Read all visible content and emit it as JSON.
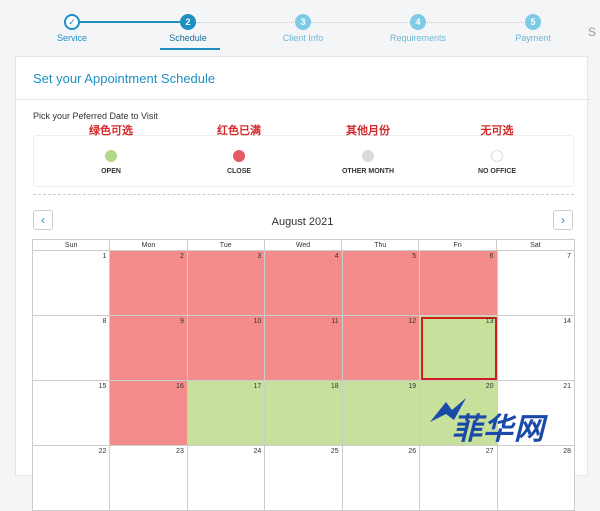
{
  "stepper": {
    "steps": [
      {
        "num": "✓",
        "label": "Service",
        "state": "done"
      },
      {
        "num": "2",
        "label": "Schedule",
        "state": "active"
      },
      {
        "num": "3",
        "label": "Client Info",
        "state": "todo"
      },
      {
        "num": "4",
        "label": "Requirements",
        "state": "todo"
      },
      {
        "num": "5",
        "label": "Payment",
        "state": "todo"
      }
    ],
    "right_cut": "S"
  },
  "panel": {
    "title": "Set your Appointment Schedule",
    "pick_label": "Pick your Peferred Date to Visit"
  },
  "legend": [
    {
      "annotation": "绿色可选",
      "label": "OPEN",
      "color": "#b4d98a"
    },
    {
      "annotation": "红色已满",
      "label": "CLOSE",
      "color": "#e45b63"
    },
    {
      "annotation": "其他月份",
      "label": "OTHER MONTH",
      "color": "#dcdcdc"
    },
    {
      "annotation": "无可选",
      "label": "NO OFFICE",
      "color": "#ffffff"
    }
  ],
  "calendar": {
    "prev_label": "‹",
    "next_label": "›",
    "month": "August 2021",
    "weekdays": [
      "Sun",
      "Mon",
      "Tue",
      "Wed",
      "Thu",
      "Fri",
      "Sat"
    ],
    "days": [
      {
        "n": "1",
        "s": "none"
      },
      {
        "n": "2",
        "s": "close"
      },
      {
        "n": "3",
        "s": "close"
      },
      {
        "n": "4",
        "s": "close"
      },
      {
        "n": "5",
        "s": "close"
      },
      {
        "n": "6",
        "s": "close"
      },
      {
        "n": "7",
        "s": "none"
      },
      {
        "n": "8",
        "s": "none"
      },
      {
        "n": "9",
        "s": "close"
      },
      {
        "n": "10",
        "s": "close"
      },
      {
        "n": "11",
        "s": "close"
      },
      {
        "n": "12",
        "s": "close"
      },
      {
        "n": "13",
        "s": "open",
        "selected": true
      },
      {
        "n": "14",
        "s": "none"
      },
      {
        "n": "15",
        "s": "none"
      },
      {
        "n": "16",
        "s": "close"
      },
      {
        "n": "17",
        "s": "open"
      },
      {
        "n": "18",
        "s": "open"
      },
      {
        "n": "19",
        "s": "open"
      },
      {
        "n": "20",
        "s": "open"
      },
      {
        "n": "21",
        "s": "none"
      },
      {
        "n": "22",
        "s": "none"
      },
      {
        "n": "23",
        "s": "none"
      },
      {
        "n": "24",
        "s": "none"
      },
      {
        "n": "25",
        "s": "none"
      },
      {
        "n": "26",
        "s": "none"
      },
      {
        "n": "27",
        "s": "none"
      },
      {
        "n": "28",
        "s": "none"
      }
    ]
  },
  "watermark": {
    "text": "菲华网"
  }
}
